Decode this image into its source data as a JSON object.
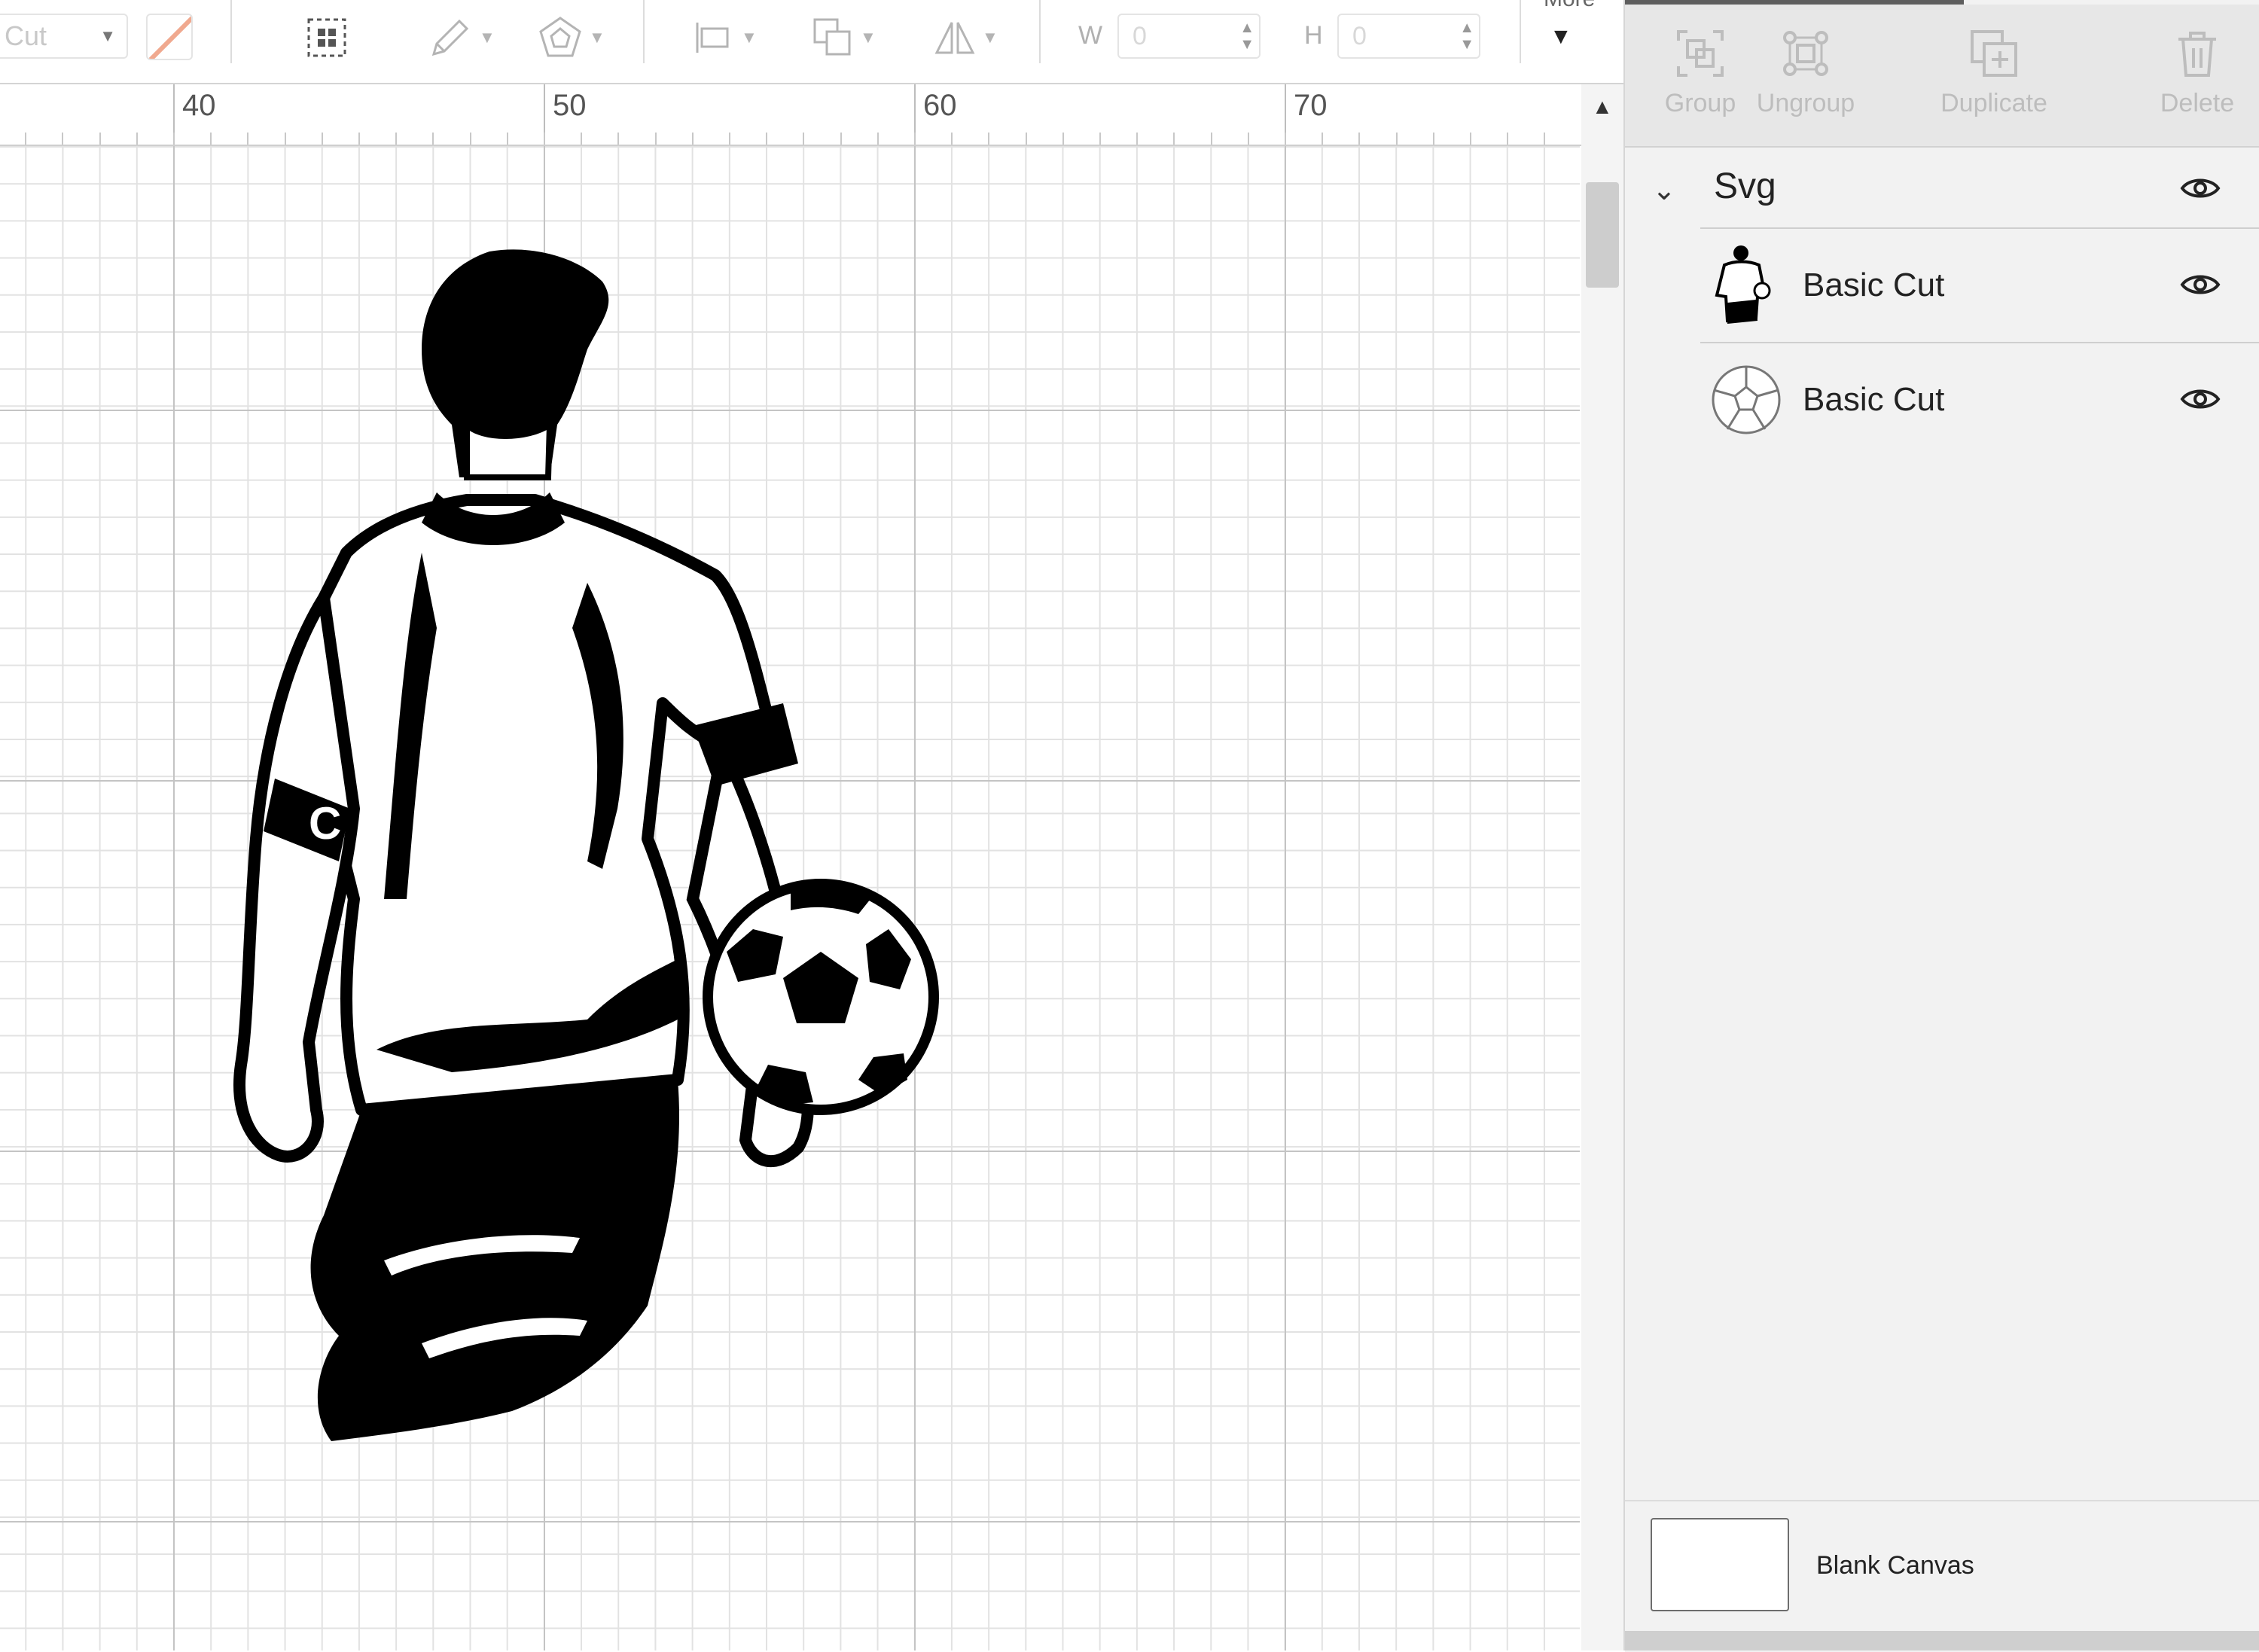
{
  "toolbar": {
    "operation_value": "Cut",
    "width_label": "W",
    "width_value": "0",
    "height_label": "H",
    "height_value": "0",
    "more_label": "More",
    "icons": [
      "select-all-icon",
      "edit-pencil-icon",
      "offset-icon",
      "align-icon",
      "arrange-icon",
      "flip-icon"
    ]
  },
  "ruler": {
    "labels": [
      "40",
      "50",
      "60",
      "70"
    ]
  },
  "panel": {
    "actions": [
      {
        "label": "Group",
        "icon": "group-icon"
      },
      {
        "label": "Ungroup",
        "icon": "ungroup-icon"
      },
      {
        "label": "Duplicate",
        "icon": "duplicate-icon"
      },
      {
        "label": "Delete",
        "icon": "delete-icon"
      }
    ],
    "group": {
      "name": "Svg"
    },
    "layers": [
      {
        "name": "Basic Cut",
        "thumb": "player-thumbnail"
      },
      {
        "name": "Basic Cut",
        "thumb": "ball-thumbnail"
      }
    ],
    "blank_canvas_label": "Blank Canvas"
  },
  "colors": {
    "accent": "#5e5e5e",
    "panel_bg": "#f2f2f2",
    "grid_major": "#c4c4c4",
    "grid_minor": "#e2e2e2",
    "swatch": "#f0a98f"
  }
}
